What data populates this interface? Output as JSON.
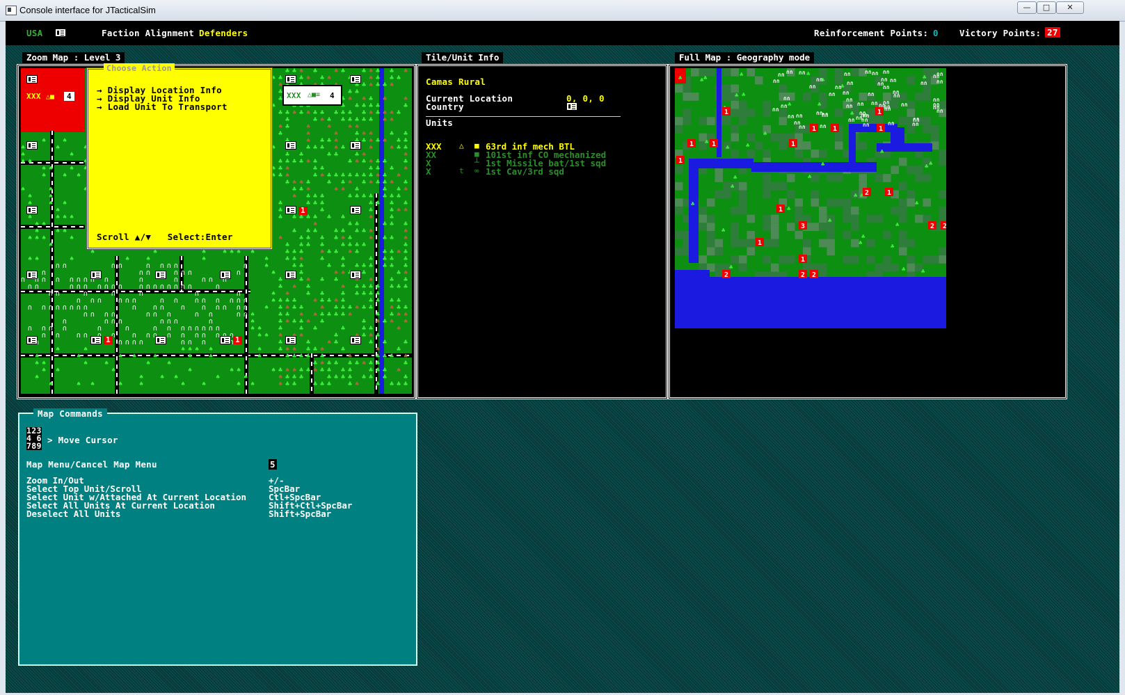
{
  "window": {
    "title": "Console interface for JTacticalSim",
    "minimize": "—",
    "maximize": "□",
    "close": "✕"
  },
  "status": {
    "country": "USA",
    "faction_label": "Faction Alignment",
    "faction_value": "Defenders",
    "reinforcement_label": "Reinforcement Points:",
    "reinforcement_value": "0",
    "victory_label": "Victory Points:",
    "victory_value": "27"
  },
  "panels": {
    "zoom_title": "Zoom Map : Level 3",
    "info_title": "Tile/Unit Info",
    "full_title": "Full Map : Geography mode"
  },
  "zoom_map": {
    "player_stack_label": "XXX",
    "player_stack_count": "4",
    "selected_stack_label": "XXX",
    "selected_stack_count": "4",
    "unit_count_badges": [
      "1",
      "1",
      "1"
    ]
  },
  "action_menu": {
    "title": "Choose Action",
    "items": [
      "→ Display Location Info",
      "→ Display Unit Info",
      "→ Load Unit To Transport"
    ],
    "footer": "Scroll ▲/▼   Select:Enter"
  },
  "tile_info": {
    "location_name": "Camas Rural",
    "current_location_label": "Current Location",
    "current_location_value": "0, 0, 0",
    "country_label": "Country",
    "units_label": "Units",
    "units": [
      {
        "echelon": "XXX",
        "symbol": "△",
        "icon": "■",
        "name": "63rd inf mech BTL",
        "active": true
      },
      {
        "echelon": "XX",
        "symbol": "",
        "icon": "■",
        "name": "101st inf CO mechanized",
        "active": false
      },
      {
        "echelon": "X",
        "symbol": "",
        "icon": "┴",
        "name": "1st Missile bat/1st sqd",
        "active": false
      },
      {
        "echelon": "X",
        "symbol": "t",
        "icon": "∞",
        "name": "1st Cav/3rd sqd",
        "active": false
      }
    ]
  },
  "full_map": {
    "badges": [
      "1",
      "1",
      "1",
      "1",
      "1",
      "1",
      "1",
      "1",
      "1",
      "2",
      "1",
      "1",
      "3",
      "2",
      "1",
      "1",
      "2",
      "2",
      "2",
      "2"
    ]
  },
  "map_commands": {
    "title": "Map Commands",
    "keypad": [
      "123",
      "4 6",
      "789"
    ],
    "move_cursor": "> Move Cursor",
    "menu_label": "Map Menu/Cancel Map Menu",
    "menu_key": "5",
    "rows": [
      {
        "label": "Zoom In/Out",
        "key": "+/-"
      },
      {
        "label": "Select Top Unit/Scroll",
        "key": "SpcBar"
      },
      {
        "label": "Select Unit w/Attached At Current Location",
        "key": "Ctl+SpcBar"
      },
      {
        "label": "Select All Units At Current Location",
        "key": "Shift+Ctl+SpcBar"
      },
      {
        "label": "Deselect All Units",
        "key": "Shift+SpcBar"
      }
    ]
  },
  "colors": {
    "accent_yellow": "#ffff00",
    "badge_red": "#e00000",
    "water_blue": "#1a1ae0",
    "terrain_green": "#0d8f12",
    "panel_teal": "#008080"
  }
}
